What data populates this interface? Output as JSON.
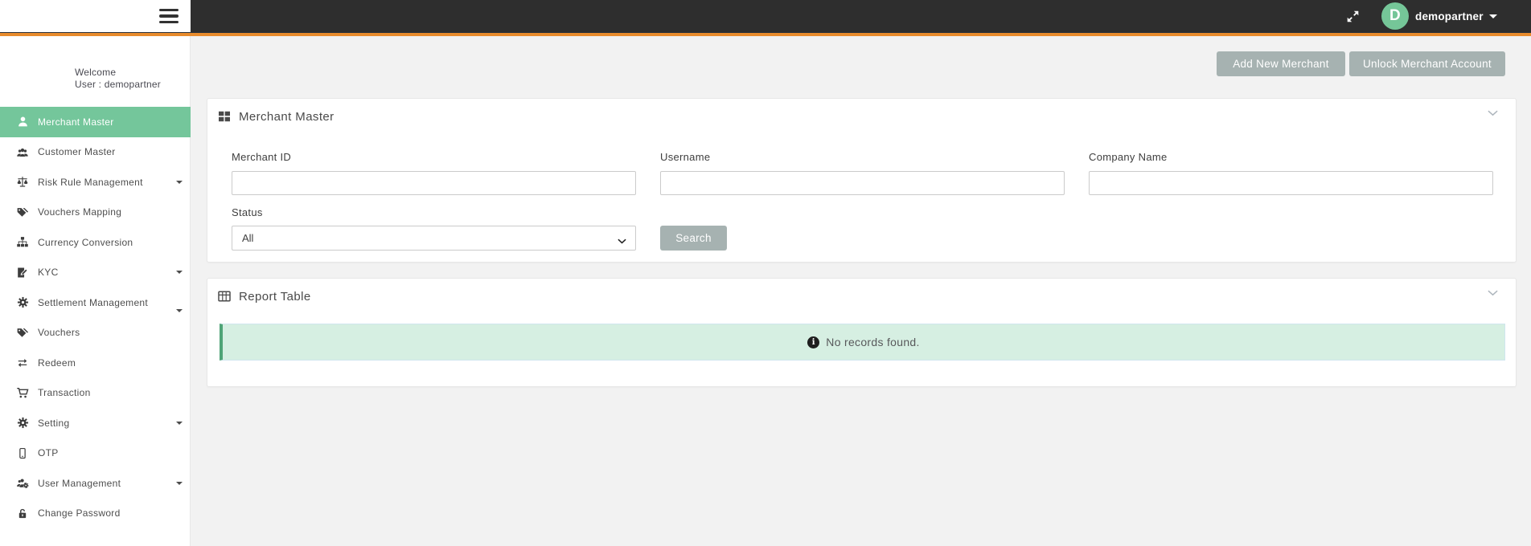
{
  "topbar": {
    "avatar_initial": "D",
    "username": "demopartner"
  },
  "sidebar": {
    "welcome_line1": "Welcome",
    "welcome_line2": "User : demopartner",
    "items": [
      {
        "label": "Merchant Master",
        "icon": "user-icon",
        "active": true,
        "caret": false
      },
      {
        "label": "Customer Master",
        "icon": "users-icon",
        "active": false,
        "caret": false
      },
      {
        "label": "Risk Rule Management",
        "icon": "scales-icon",
        "active": false,
        "caret": true
      },
      {
        "label": "Vouchers Mapping",
        "icon": "tags-icon",
        "active": false,
        "caret": false
      },
      {
        "label": "Currency Conversion",
        "icon": "sitemap-icon",
        "active": false,
        "caret": false
      },
      {
        "label": "KYC",
        "icon": "file-edit-icon",
        "active": false,
        "caret": true
      },
      {
        "label": "Settlement Management",
        "icon": "gear-icon",
        "active": false,
        "caret": true,
        "caret_low": true
      },
      {
        "label": "Vouchers",
        "icon": "tags-icon",
        "active": false,
        "caret": false
      },
      {
        "label": "Redeem",
        "icon": "exchange-icon",
        "active": false,
        "caret": false
      },
      {
        "label": "Transaction",
        "icon": "cart-icon",
        "active": false,
        "caret": false
      },
      {
        "label": "Setting",
        "icon": "gear-icon",
        "active": false,
        "caret": true
      },
      {
        "label": "OTP",
        "icon": "mobile-icon",
        "active": false,
        "caret": false
      },
      {
        "label": "User Management",
        "icon": "users-gear-icon",
        "active": false,
        "caret": true
      },
      {
        "label": "Change Password",
        "icon": "lock-icon",
        "active": false,
        "caret": false
      }
    ]
  },
  "actions": {
    "add_new_merchant": "Add New Merchant",
    "unlock_merchant_account": "Unlock Merchant Account"
  },
  "merchant_master_panel": {
    "title": "Merchant Master",
    "labels": {
      "merchant_id": "Merchant ID",
      "username": "Username",
      "company_name": "Company Name",
      "status": "Status"
    },
    "values": {
      "merchant_id": "",
      "username": "",
      "company_name": "",
      "status": "All"
    },
    "search_label": "Search"
  },
  "report_panel": {
    "title": "Report Table",
    "empty_message": "No records found."
  },
  "colors": {
    "accent_green": "#74c69b",
    "topbar_orange": "#e88b2c",
    "topbar_dark": "#2e2e2e",
    "button_gray": "#a6b2b1",
    "alert_bg": "#d6efe2",
    "alert_accent": "#4fa477"
  }
}
